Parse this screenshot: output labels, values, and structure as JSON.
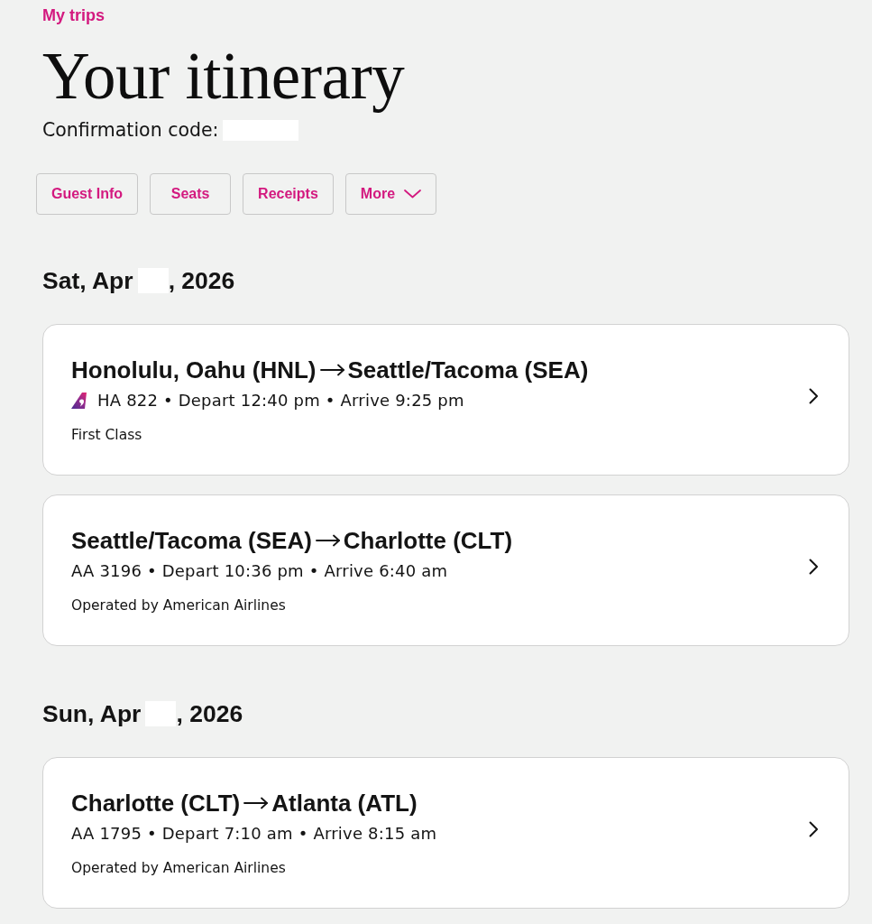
{
  "breadcrumb": {
    "label": "My trips"
  },
  "title": "Your itinerary",
  "confirmation": {
    "label": "Confirmation code:",
    "redacted": true
  },
  "actions": [
    {
      "label": "Guest Info",
      "kind": "button"
    },
    {
      "label": "Seats",
      "kind": "button"
    },
    {
      "label": "Receipts",
      "kind": "button"
    },
    {
      "label": "More",
      "kind": "menu"
    }
  ],
  "days": [
    {
      "date_start": "Sat, Apr",
      "date_end": ", 2026",
      "day_redacted": true,
      "flights": [
        {
          "origin": "Honolulu, Oahu (HNL)",
          "destination": "Seattle/Tacoma (SEA)",
          "carrier_logo": true,
          "details": "HA 822 • Depart 12:40 pm • Arrive 9:25 pm",
          "note": "First Class"
        },
        {
          "origin": "Seattle/Tacoma (SEA)",
          "destination": "Charlotte (CLT)",
          "carrier_logo": false,
          "details": "AA 3196 • Depart 10:36 pm • Arrive 6:40 am",
          "note": "Operated by American Airlines"
        }
      ]
    },
    {
      "date_start": "Sun, Apr",
      "date_end": ", 2026",
      "day_redacted": true,
      "flights": [
        {
          "origin": "Charlotte (CLT)",
          "destination": "Atlanta (ATL)",
          "carrier_logo": false,
          "details": "AA 1795 • Depart 7:10 am • Arrive 8:15 am",
          "note": "Operated by American Airlines"
        }
      ]
    }
  ]
}
